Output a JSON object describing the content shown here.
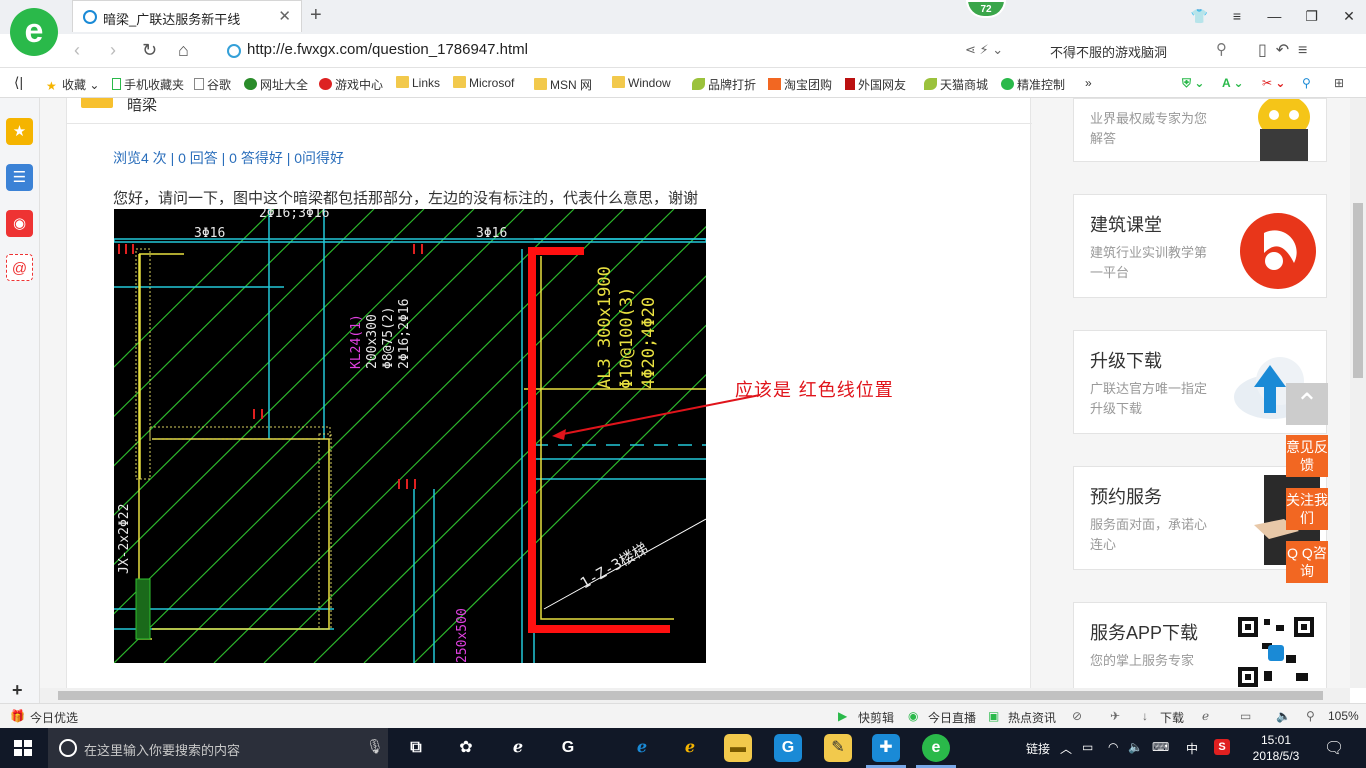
{
  "browser": {
    "tab_title": "暗梁_广联达服务新干线",
    "url": "http://e.fwxgx.com/question_1786947.html",
    "notification_count": "72",
    "search_hint": "不得不服的游戏脑洞"
  },
  "bookmarks": [
    {
      "label": "收藏",
      "icon": "star-icon"
    },
    {
      "label": "手机收藏夹",
      "icon": "phone-icon"
    },
    {
      "label": "谷歌",
      "icon": "page-icon"
    },
    {
      "label": "网址大全",
      "icon": "globe-icon"
    },
    {
      "label": "游戏中心",
      "icon": "game-icon"
    },
    {
      "label": "Links",
      "icon": "folder-icon"
    },
    {
      "label": "Microsof",
      "icon": "folder-icon"
    },
    {
      "label": "MSN 网",
      "icon": "folder-icon"
    },
    {
      "label": "Window",
      "icon": "folder-icon"
    },
    {
      "label": "品牌打折",
      "icon": "leaf-icon"
    },
    {
      "label": "淘宝团购",
      "icon": "taobao-icon"
    },
    {
      "label": "外国网友",
      "icon": "bookmark-icon"
    },
    {
      "label": "天猫商城",
      "icon": "leaf-icon"
    },
    {
      "label": "精准控制",
      "icon": "wechat-icon"
    }
  ],
  "page": {
    "header_text": "暗梁",
    "stats": "浏览4 次 | 0 回答 | 0 答得好 | 0问得好",
    "question": "您好，请问一下，图中这个暗梁都包括那部分，左边的没有标注的，代表什么意思，谢谢",
    "annotation": "应该是 红色线位置",
    "cad_labels": {
      "top1": "3Φ16",
      "top2": "2Φ16;3Φ16",
      "top3": "3Φ16",
      "kl": "KL24(1)",
      "kl_size": "200x300",
      "kl_stirrup": "Φ8@75(2)",
      "kl_bars": "2Φ16;2Φ16",
      "al": "AL3 300x1900",
      "al_stirrup": "Φ10@100(3)",
      "al_bars": "4Φ20;4Φ20",
      "stair": "1-Z-3楼梯",
      "left": "JX-2x2Φ22",
      "bottom": "250x500"
    }
  },
  "sidebar_cards": [
    {
      "title": "",
      "desc": "业界最权威专家为您解答"
    },
    {
      "title": "建筑课堂",
      "desc": "建筑行业实训教学第一平台"
    },
    {
      "title": "升级下载",
      "desc": "广联达官方唯一指定升级下载"
    },
    {
      "title": "预约服务",
      "desc": "服务面对面，承诺心连心"
    },
    {
      "title": "服务APP下载",
      "desc": "您的掌上服务专家"
    }
  ],
  "float_buttons": [
    "意见反馈",
    "关注我们",
    "Q Q咨询"
  ],
  "statusbar": {
    "left": "今日优选",
    "items": [
      "快剪辑",
      "今日直播",
      "热点资讯",
      "下载"
    ],
    "zoom": "105%"
  },
  "taskbar": {
    "search_placeholder": "在这里输入你要搜索的内容",
    "tray_label": "链接",
    "ime": "中",
    "time": "15:01",
    "date": "2018/5/3"
  },
  "colors": {
    "accent_orange": "#f26722",
    "link_blue": "#2a6ebb",
    "annotation_red": "#e0141b",
    "browser_green": "#2ab94a"
  }
}
